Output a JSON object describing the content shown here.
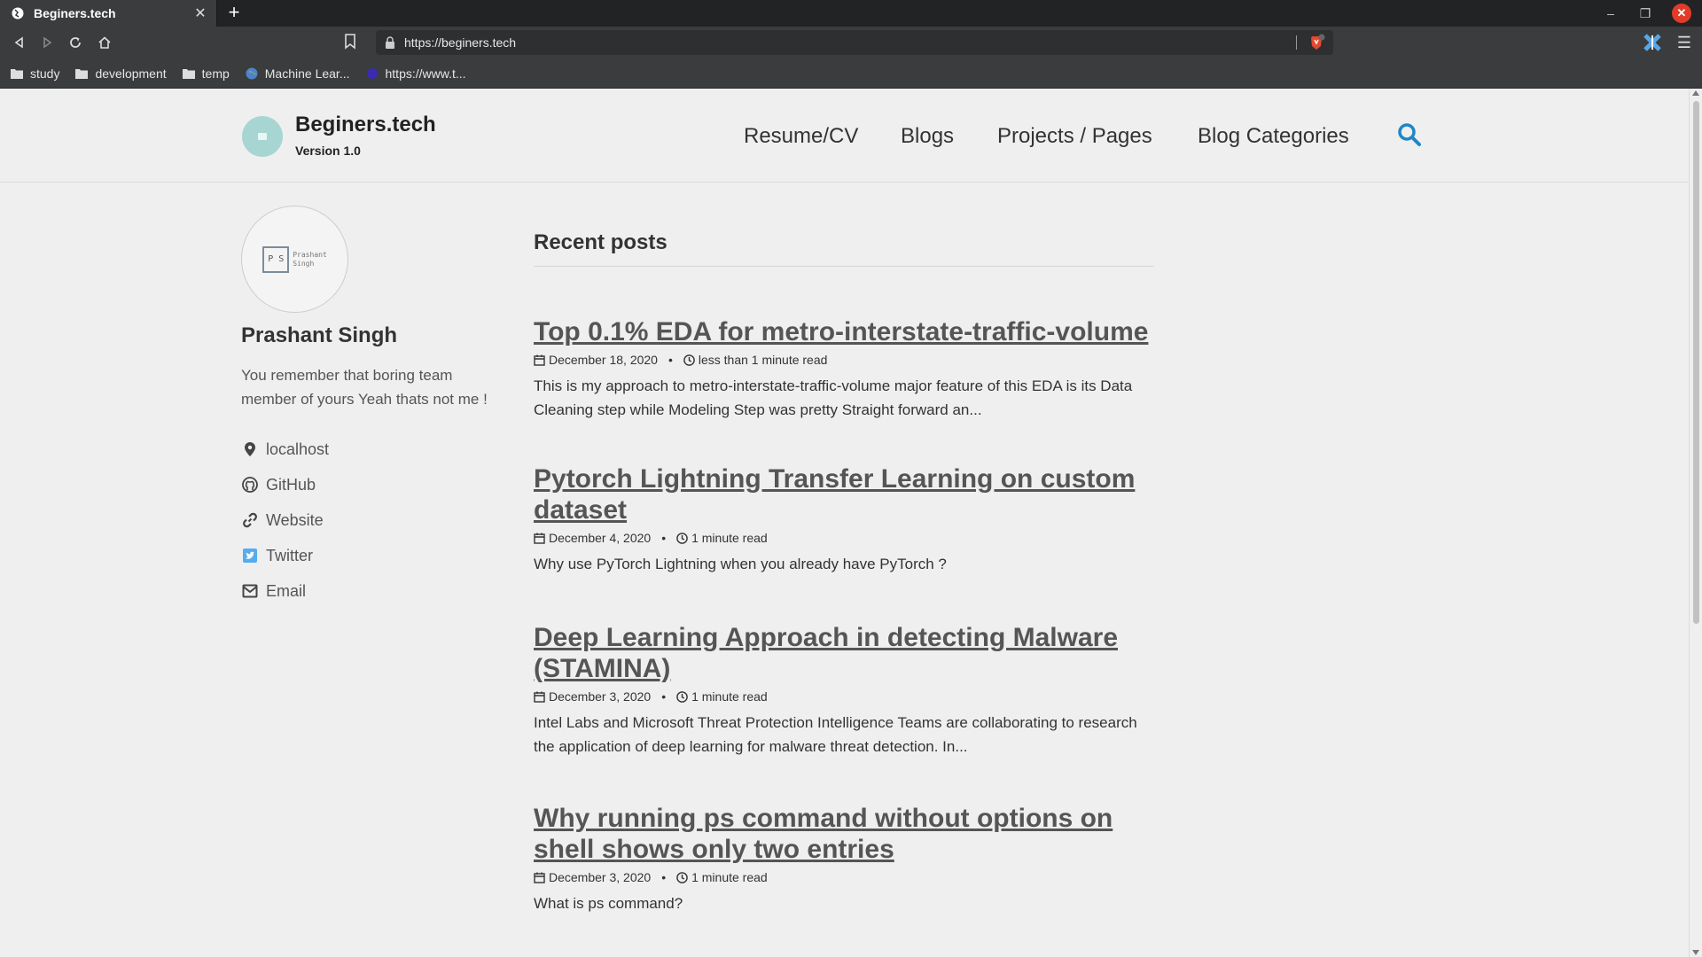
{
  "browser": {
    "tab_title": "Beginers.tech",
    "url": "https://beginers.tech",
    "bookmarks": [
      {
        "label": "study",
        "icon": "folder-icon"
      },
      {
        "label": "development",
        "icon": "folder-icon"
      },
      {
        "label": "temp",
        "icon": "folder-icon"
      },
      {
        "label": "Machine Lear...",
        "icon": "globe-icon"
      },
      {
        "label": "https://www.t...",
        "icon": "site-icon"
      }
    ]
  },
  "site": {
    "title": "Beginers.tech",
    "subtitle": "Version 1.0",
    "nav": [
      "Resume/CV",
      "Blogs",
      "Projects / Pages",
      "Blog Categories"
    ],
    "accent_color": "#1e87c8"
  },
  "author": {
    "name": "Prashant Singh",
    "avatar_text_initials": "P S",
    "avatar_text_name_1": "Prashant",
    "avatar_text_name_2": "Singh",
    "bio": "You remember that boring team member of yours Yeah thats not me !",
    "links": [
      {
        "label": "localhost",
        "icon": "map-marker-icon"
      },
      {
        "label": "GitHub",
        "icon": "github-icon"
      },
      {
        "label": "Website",
        "icon": "link-icon"
      },
      {
        "label": "Twitter",
        "icon": "twitter-icon"
      },
      {
        "label": "Email",
        "icon": "envelope-icon"
      }
    ]
  },
  "main": {
    "section_title": "Recent posts",
    "posts": [
      {
        "title": "Top 0.1% EDA for metro-interstate-traffic-volume",
        "date": "December 18, 2020",
        "read_time": "less than 1 minute read",
        "excerpt": "This is my approach to metro-interstate-traffic-volume major feature of this EDA is its Data Cleaning step while Modeling Step was pretty Straight forward an..."
      },
      {
        "title": "Pytorch Lightning Transfer Learning on custom dataset",
        "date": "December 4, 2020",
        "read_time": "1 minute read",
        "excerpt": "Why use PyTorch Lightning when you already have PyTorch ?"
      },
      {
        "title": "Deep Learning Approach in detecting Malware (STAMINA)",
        "date": "December 3, 2020",
        "read_time": "1 minute read",
        "excerpt": "Intel Labs and Microsoft Threat Protection Intelligence Teams are collaborating to research the application of deep learning for malware threat detection. In..."
      },
      {
        "title": "Why running ps command without options on shell shows only two entries",
        "date": "December 3, 2020",
        "read_time": "1 minute read",
        "excerpt": "What is ps command?"
      }
    ],
    "separator": "•"
  }
}
